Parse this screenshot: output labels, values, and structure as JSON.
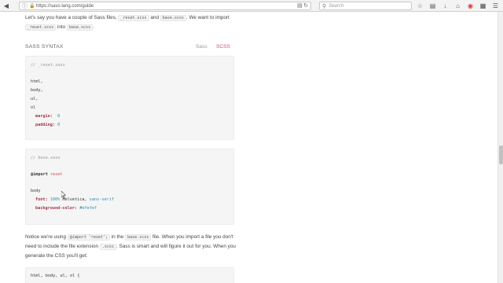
{
  "browser": {
    "url": "https://sass-lang.com/guide",
    "search_placeholder": "Search"
  },
  "intro": {
    "t1": "Let's say you have a couple of Sass files, ",
    "c1": "_reset.scss",
    "t2": " and ",
    "c2": "base.scss",
    "t3": ". We want to import ",
    "c3": "_reset.scss",
    "t4": " into ",
    "c4": "base.scss",
    "t5": "."
  },
  "syntax": {
    "title": "SASS SYNTAX",
    "tab_sass": "Sass",
    "tab_scss": "SCSS"
  },
  "code1": {
    "comment": "// _reset.sass",
    "l1": "html,",
    "l2": "body,",
    "l3": "ul,",
    "l4": "ol",
    "l5_prop": "margin:",
    "l5_val": "0",
    "l6_prop": "padding:",
    "l6_val": "0"
  },
  "code2": {
    "comment": "// base.sass",
    "import_kw": "@import",
    "import_val": "reset",
    "sel": "body",
    "font_prop": "font:",
    "font_num": "100%",
    "font_rest": "Helvetica,",
    "font_fn": "sans-serif",
    "bg_prop": "background-color:",
    "bg_val": "#efefef"
  },
  "para2": {
    "t1": "Notice we're using ",
    "c1": "@import 'reset';",
    "t2": " in the ",
    "c2": "base.scss",
    "t3": " file. When you import a file you don't need to include the file extension ",
    "c3": ".scss",
    "t4": ". Sass is smart and will figure it out for you. When you generate the CSS you'll get:"
  },
  "code3": {
    "l1": "html, body, ul, ol {"
  }
}
